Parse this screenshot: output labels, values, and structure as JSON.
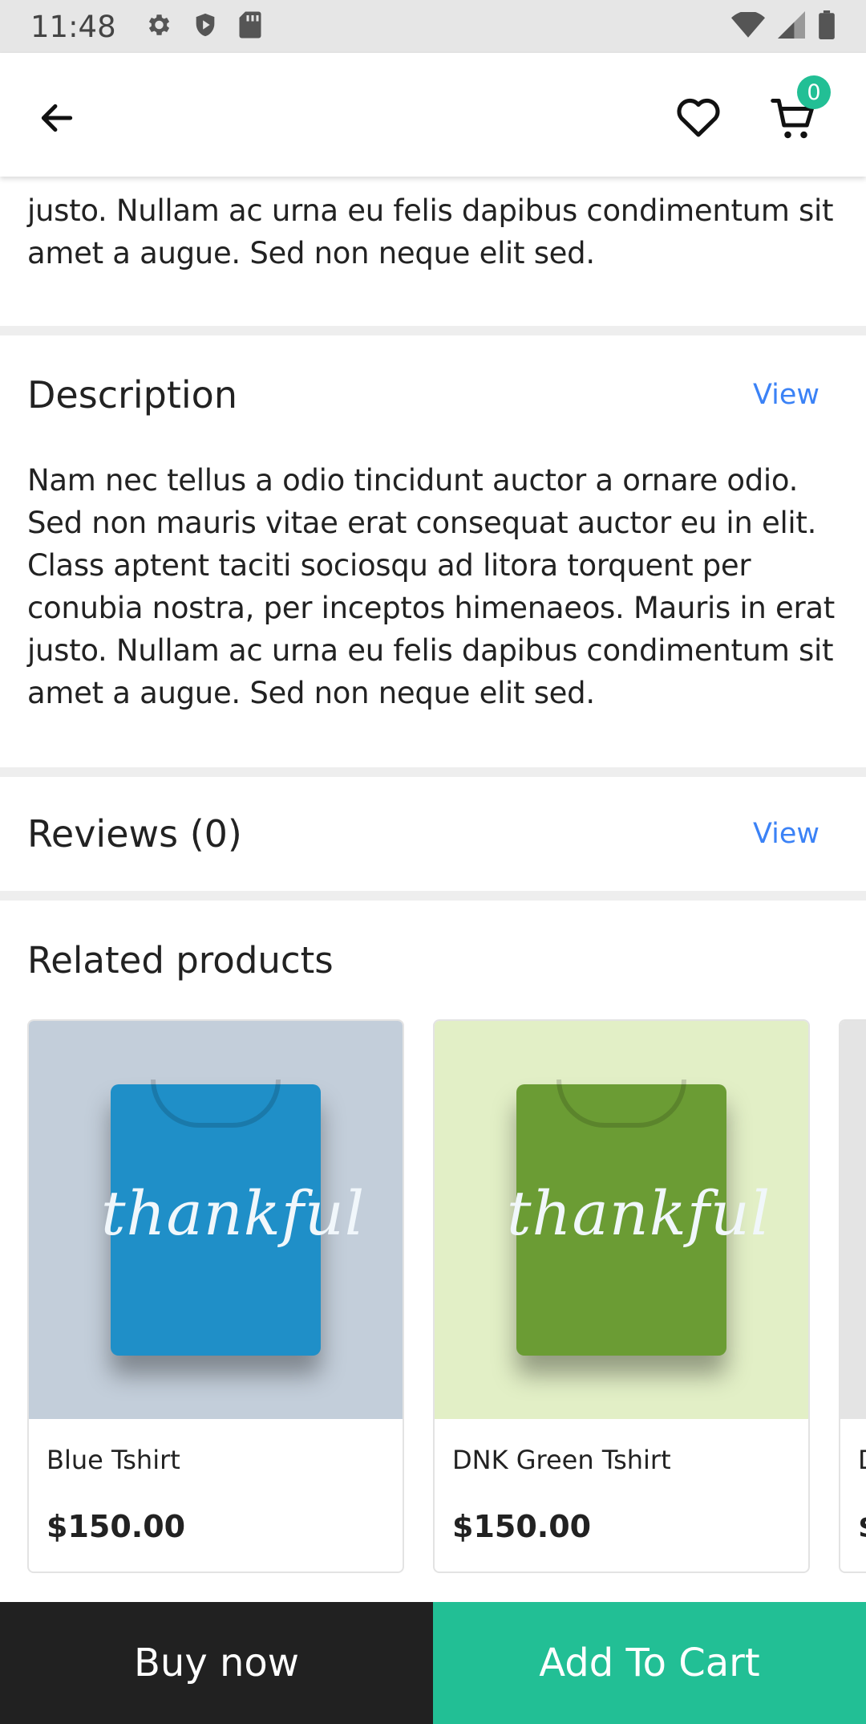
{
  "status_bar": {
    "time": "11:48",
    "icons_left": [
      "settings-icon",
      "shield-icon",
      "sd-card-icon"
    ],
    "icons_right": [
      "wifi-icon",
      "signal-icon",
      "battery-icon"
    ]
  },
  "appbar": {
    "back_icon": "arrow-left-icon",
    "favorite_icon": "heart-icon",
    "cart_icon": "cart-icon",
    "cart_count": "0"
  },
  "top_paragraph": {
    "lines": [
      "justo. Nullam ac urna eu felis dapibus condimentum sit",
      "amet a augue. Sed non neque elit sed."
    ]
  },
  "description": {
    "title": "Description",
    "view_label": "View",
    "lines": [
      "Nam nec tellus a odio tincidunt auctor a ornare odio.",
      "Sed non mauris vitae erat consequat auctor eu in elit.",
      "Class aptent taciti sociosqu ad litora torquent per",
      "conubia nostra, per inceptos himenaeos. Mauris in erat",
      "justo. Nullam ac urna eu felis dapibus condimentum sit",
      "amet a augue. Sed non neque elit sed."
    ]
  },
  "reviews": {
    "title": "Reviews (0)",
    "view_label": "View"
  },
  "related": {
    "title": "Related products",
    "products": [
      {
        "name": "Blue Tshirt",
        "price": "$150.00",
        "bg": "#c3ceda",
        "shirt_color": "#1f8fc8",
        "shirt_text": "thankful"
      },
      {
        "name": "DNK Green Tshirt",
        "price": "$150.00",
        "bg": "#e2efc6",
        "shirt_color": "#6b9c34",
        "shirt_text": "thankful"
      },
      {
        "name": "D",
        "price": "$",
        "bg": "#e4e4e4",
        "shirt_color": "#d9d9d9",
        "shirt_text": ""
      }
    ]
  },
  "bottom_bar": {
    "buy_label": "Buy now",
    "add_label": "Add To Cart",
    "add_color": "#22bf95"
  }
}
